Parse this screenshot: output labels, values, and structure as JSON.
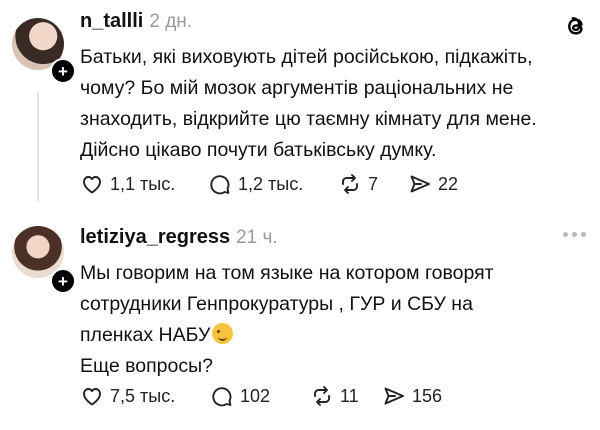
{
  "posts": [
    {
      "username": "n_tallli",
      "time": "2 дн.",
      "text_lines": [
        "Батьки, які виховують дітей російською, підкажіть,",
        "чому? Бо мій мозок аргументів раціональних не",
        "знаходить, відкрийте цю таємну кімнату для мене.",
        "Дійсно цікаво почути батьківську думку."
      ],
      "likes": "1,1 тыс.",
      "replies": "1,2 тыс.",
      "reposts": "7",
      "shares": "22"
    },
    {
      "username": "letiziya_regress",
      "time": "21 ч.",
      "text_lines": [
        "Мы говорим на том языке на котором говорят",
        "сотрудники Генпрокуратуры , ГУР и СБУ на",
        "пленках НАБУ",
        "Еще вопросы?"
      ],
      "likes": "7,5 тыс.",
      "replies": "102",
      "reposts": "11",
      "shares": "156"
    }
  ],
  "icons": {
    "like": "heart-icon",
    "reply": "comment-icon",
    "repost": "repost-icon",
    "share": "send-icon",
    "logo": "threads-logo",
    "follow": "plus-icon",
    "more": "more-icon"
  }
}
